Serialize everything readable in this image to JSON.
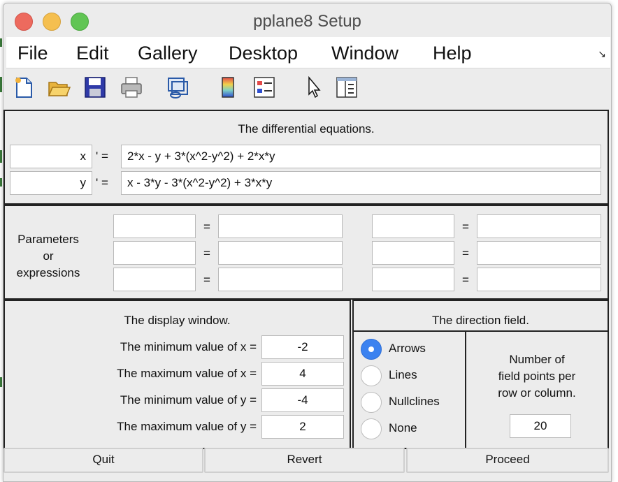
{
  "window": {
    "title": "pplane8 Setup"
  },
  "menu": {
    "items": [
      "File",
      "Edit",
      "Gallery",
      "Desktop",
      "Window",
      "Help"
    ],
    "corner_glyph": "↘"
  },
  "toolbar": {
    "icons": [
      "new-file-icon",
      "open-folder-icon",
      "save-icon",
      "print-icon",
      "link-icon",
      "colorbar-icon",
      "legend-icon",
      "pointer-icon",
      "property-editor-icon"
    ]
  },
  "equations": {
    "caption": "The differential equations.",
    "prime": "' =",
    "rows": [
      {
        "var": "x",
        "expr": "2*x - y + 3*(x^2-y^2) + 2*x*y"
      },
      {
        "var": "y",
        "expr": "x - 3*y - 3*(x^2-y^2) + 3*x*y"
      }
    ]
  },
  "parameters": {
    "label_lines": [
      "Parameters",
      "or",
      "expressions"
    ],
    "equals": "="
  },
  "display": {
    "caption": "The display window.",
    "rows": [
      {
        "label": "The minimum value of x =",
        "value": "-2"
      },
      {
        "label": "The maximum value of x =",
        "value": "4"
      },
      {
        "label": "The minimum value of y =",
        "value": "-4"
      },
      {
        "label": "The maximum value of y =",
        "value": "2"
      }
    ]
  },
  "direction": {
    "caption": "The direction field.",
    "options": [
      "Arrows",
      "Lines",
      "Nullclines",
      "None"
    ],
    "selected": "Arrows",
    "points_label_lines": [
      "Number of",
      "field points per",
      "row or column."
    ],
    "points_value": "20"
  },
  "buttons": {
    "quit": "Quit",
    "revert": "Revert",
    "proceed": "Proceed"
  }
}
